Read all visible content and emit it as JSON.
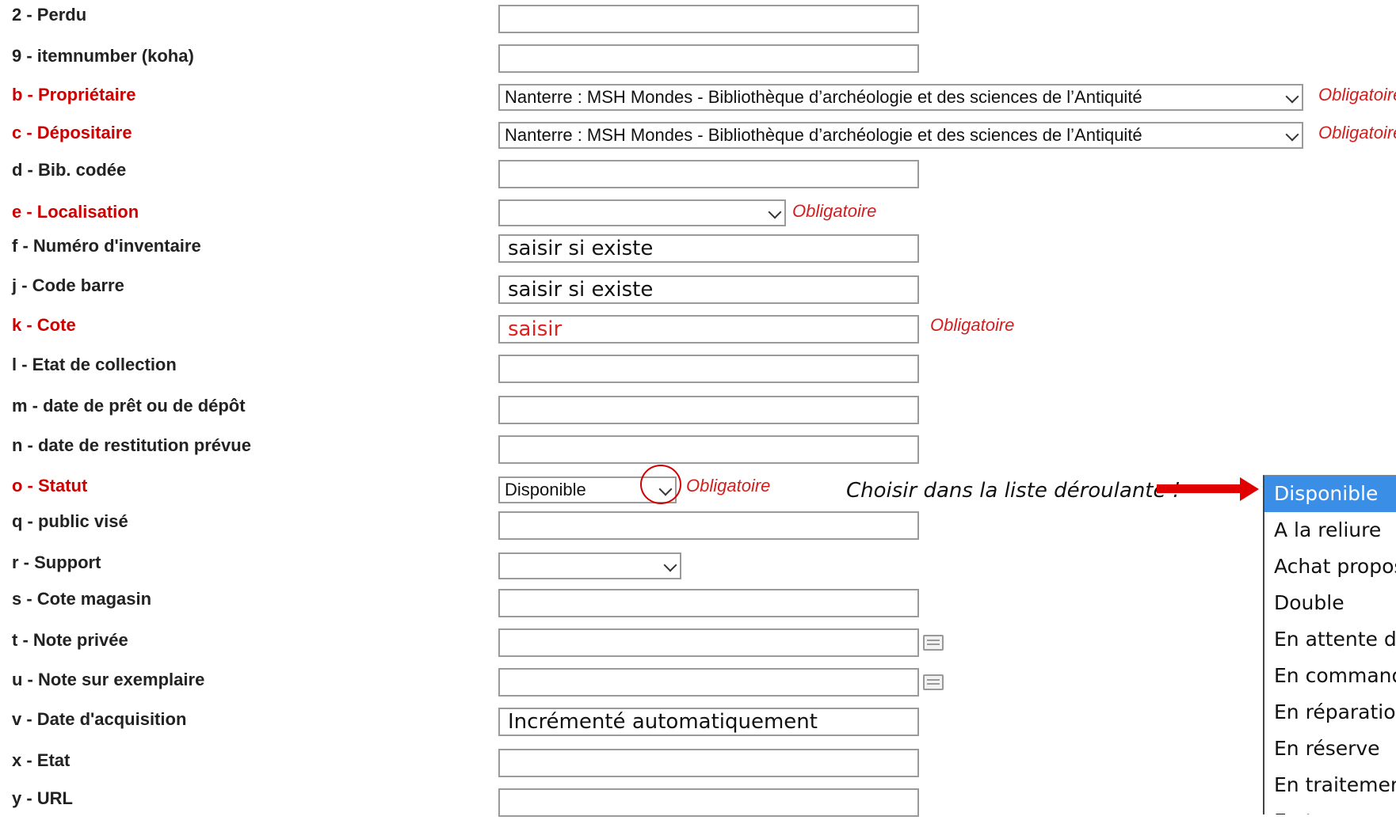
{
  "obligatoire": "Obligatoire",
  "fields": {
    "perdu": {
      "label": "2 - Perdu",
      "value": ""
    },
    "itemnumber": {
      "label": "9 - itemnumber (koha)",
      "value": ""
    },
    "proprietaire": {
      "label": "b - Propriétaire",
      "value": "Nanterre : MSH Mondes - Bibliothèque d’archéologie et des sciences de l’Antiquité"
    },
    "depositaire": {
      "label": "c - Dépositaire",
      "value": "Nanterre : MSH Mondes - Bibliothèque d’archéologie et des sciences de l’Antiquité"
    },
    "bib_codee": {
      "label": "d - Bib. codée",
      "value": ""
    },
    "localisation": {
      "label": "e - Localisation",
      "value": ""
    },
    "numero_inventaire": {
      "label": "f - Numéro d'inventaire",
      "value": "saisir si existe"
    },
    "code_barre": {
      "label": "j - Code barre",
      "value": "saisir si existe"
    },
    "cote": {
      "label": "k - Cote",
      "value": "saisir"
    },
    "etat_collection": {
      "label": "l - Etat de collection",
      "value": ""
    },
    "date_pret": {
      "label": "m - date de prêt ou de dépôt",
      "value": ""
    },
    "date_restitution": {
      "label": "n - date de restitution prévue",
      "value": ""
    },
    "statut": {
      "label": "o - Statut",
      "value": "Disponible"
    },
    "public_vise": {
      "label": "q - public visé",
      "value": ""
    },
    "support": {
      "label": "r - Support",
      "value": ""
    },
    "cote_magasin": {
      "label": "s - Cote magasin",
      "value": ""
    },
    "note_privee": {
      "label": "t - Note privée",
      "value": ""
    },
    "note_exemplaire": {
      "label": "u - Note sur exemplaire",
      "value": ""
    },
    "date_acquisition": {
      "label": "v - Date d'acquisition",
      "value": "Incrémenté automatiquement"
    },
    "etat": {
      "label": "x - Etat",
      "value": ""
    },
    "url": {
      "label": "y - URL",
      "value": ""
    }
  },
  "annotation": "Choisir dans la liste déroulante !",
  "dropdown": {
    "options": [
      "Disponible",
      "A la reliure",
      "Achat propos",
      "Double",
      "En attente de",
      "En commande",
      "En réparation",
      "En réserve",
      "En traitement",
      "En tra"
    ],
    "selected_index": 0
  },
  "colors": {
    "required": "#cc0000",
    "selected_option": "#3a8ee6",
    "annotation_arrow": "#e00000"
  },
  "icons": {
    "note_popup": "note-popup-icon",
    "select_chevron": "chevron-down-icon"
  }
}
